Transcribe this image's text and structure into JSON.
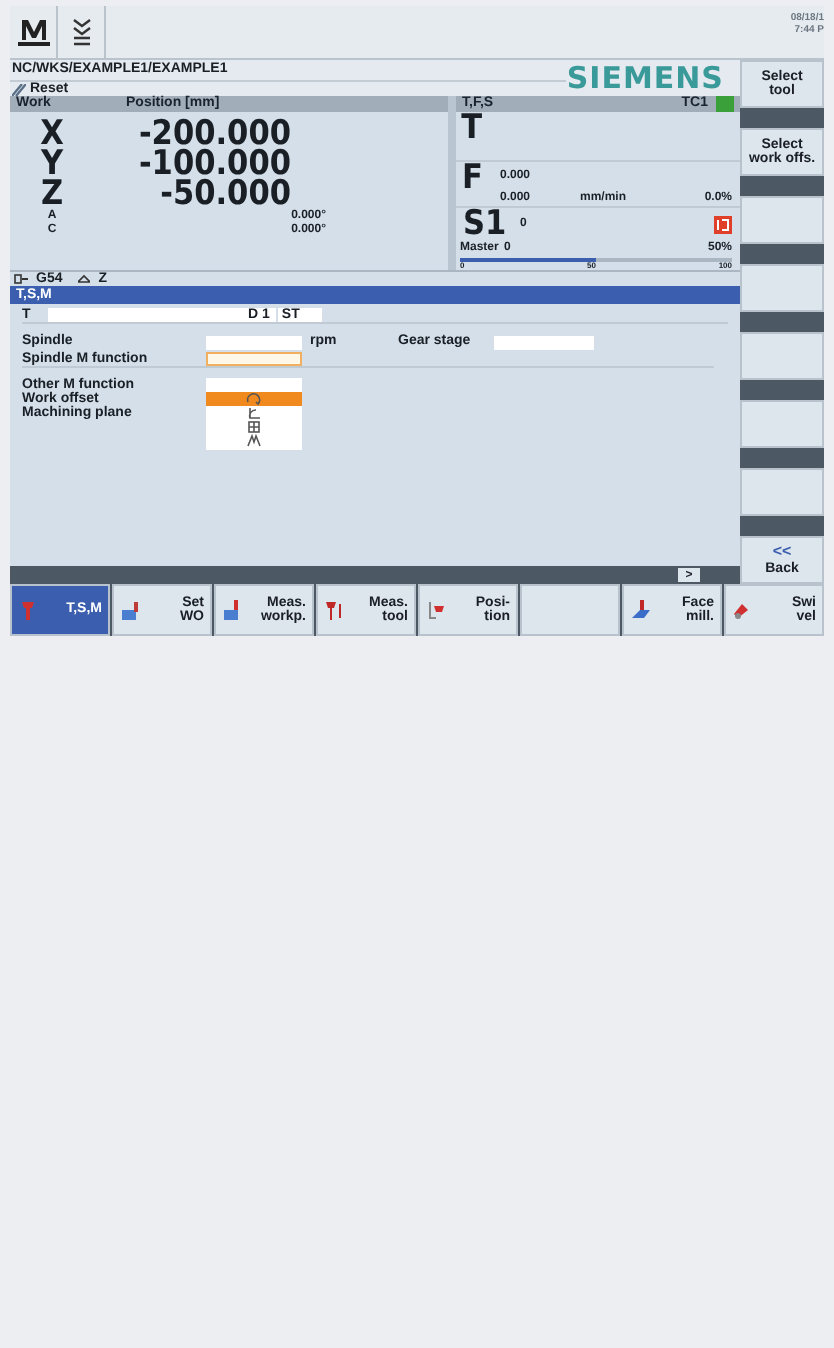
{
  "top_bar": {
    "date": "08/18/1",
    "time": "7:44 P"
  },
  "program_path": "NC/WKS/EXAMPLE1/EXAMPLE1",
  "logo": "SIEMENS",
  "channel_state": "Reset",
  "axes_panel": {
    "columns": [
      "Work",
      "Position [mm]"
    ],
    "axes": [
      {
        "name": "X",
        "value": "-200.000",
        "kind": "main"
      },
      {
        "name": "Y",
        "value": "-100.000",
        "kind": "main"
      },
      {
        "name": "Z",
        "value": "-50.000",
        "kind": "main"
      },
      {
        "name": "A",
        "value": "0.000°",
        "kind": "rotary"
      },
      {
        "name": "C",
        "value": "0.000°",
        "kind": "rotary"
      }
    ]
  },
  "tfs_panel": {
    "title": "T,F,S",
    "tool_carrier": "TC1",
    "tool_label": "T",
    "feed_label": "F",
    "feed_value": "0.000",
    "feed_actual": "0.000",
    "feed_unit": "mm/min",
    "feed_override": "0.0%",
    "spindle_label": "S1",
    "spindle_value": "0",
    "spindle_mode": "Master",
    "spindle_actual": "0",
    "spindle_override": "50%",
    "spindle_load": {
      "level": 0.5
    },
    "scale": [
      "0",
      "50",
      "100"
    ]
  },
  "status_line": {
    "work_offset": "G54",
    "plane": "Z"
  },
  "form": {
    "title": "T,S,M",
    "tool_label": "T",
    "edge": "D 1",
    "sister_tool": "ST",
    "spindle_label": "Spindle",
    "spindle_unit": "rpm",
    "gear_stage_label": "Gear stage",
    "spindle_m_label": "Spindle M function",
    "other_m_label": "Other M function",
    "work_offset_label": "Work offset",
    "plane_label": "Machining plane",
    "dropdown_options": [
      {
        "selected": true
      },
      {
        "selected": false
      },
      {
        "selected": false
      },
      {
        "selected": false
      }
    ]
  },
  "scroll_button": ">",
  "vertical_softkeys": [
    {
      "kind": "text",
      "lines": [
        "Select",
        "tool"
      ]
    },
    {
      "kind": "text",
      "lines": [
        "Select",
        "work offs."
      ]
    },
    {
      "kind": "blank"
    },
    {
      "kind": "blank"
    },
    {
      "kind": "blank"
    },
    {
      "kind": "blank"
    },
    {
      "kind": "blank"
    },
    {
      "kind": "back",
      "symbol": "<<",
      "lines": [
        "Back"
      ]
    }
  ],
  "horizontal_softkeys": [
    {
      "kind": "text",
      "lines": [
        "T,S,M"
      ],
      "selected": true
    },
    {
      "kind": "text",
      "lines": [
        "Set",
        "WO"
      ],
      "selected": false
    },
    {
      "kind": "text",
      "lines": [
        "Meas.",
        "workp."
      ],
      "selected": false
    },
    {
      "kind": "text",
      "lines": [
        "Meas.",
        "tool"
      ],
      "selected": false
    },
    {
      "kind": "text",
      "lines": [
        "Posi-",
        "tion"
      ],
      "selected": false
    },
    {
      "kind": "blank",
      "selected": false
    },
    {
      "kind": "text",
      "lines": [
        "Face",
        "mill."
      ],
      "selected": false
    },
    {
      "kind": "text",
      "lines": [
        "Swi",
        "vel"
      ],
      "selected": false
    }
  ]
}
